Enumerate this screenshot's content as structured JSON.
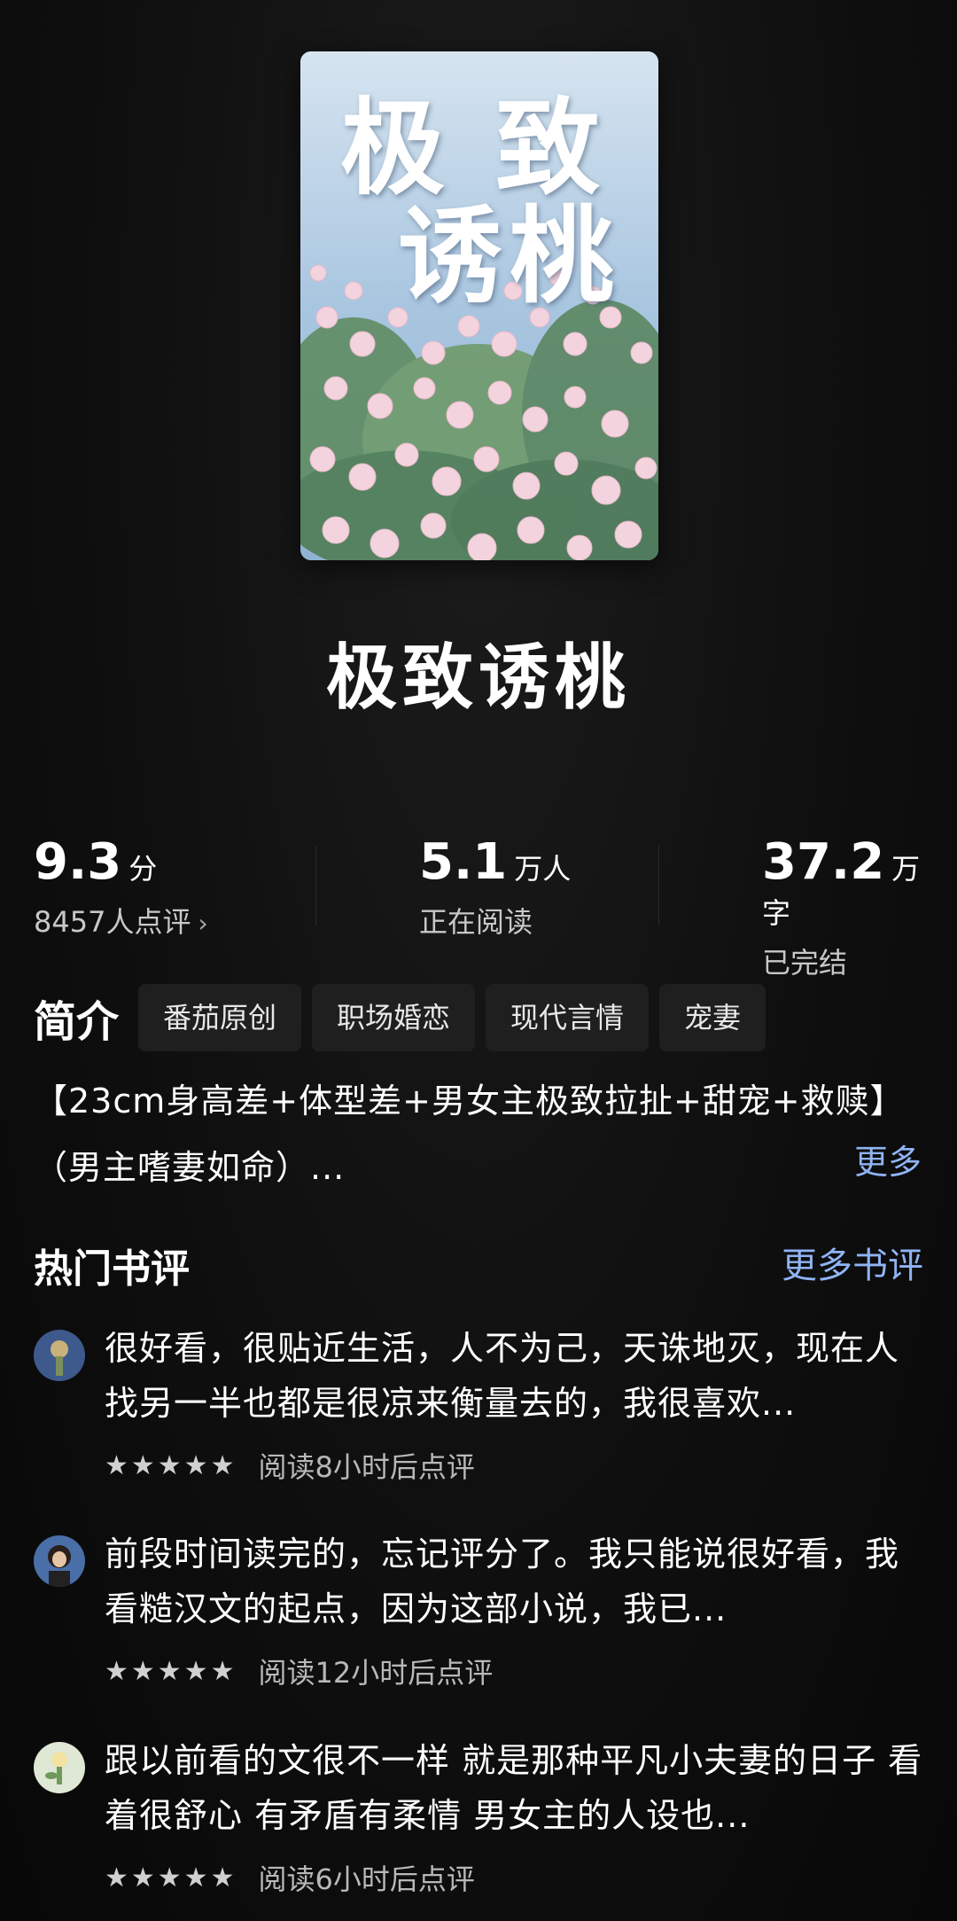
{
  "cover": {
    "title_line1": "极 致",
    "title_line2": "诱桃"
  },
  "book": {
    "title": "极致诱桃"
  },
  "stats": {
    "score": "9.3",
    "score_unit": "分",
    "reviews_count": "8457人点评",
    "readers": "5.1",
    "readers_unit": "万人",
    "readers_label": "正在阅读",
    "words": "37.2",
    "words_unit": "万字",
    "status": "已完结"
  },
  "intro": {
    "label": "简介",
    "tags": [
      "番茄原创",
      "职场婚恋",
      "现代言情",
      "宠妻"
    ],
    "line1": "【23cm身高差+体型差+男女主极致拉扯+甜宠+救赎】",
    "line2": "（男主嗜妻如命）...",
    "more": "更多"
  },
  "reviews": {
    "title": "热门书评",
    "more": "更多书评",
    "items": [
      {
        "text": "很好看，很贴近生活，人不为己，天诛地灭，现在人找另一半也都是很凉来衡量去的，我很喜欢...",
        "stars": "★★★★★",
        "meta": "阅读8小时后点评"
      },
      {
        "text": "前段时间读完的，忘记评分了。我只能说很好看，我看糙汉文的起点，因为这部小说，我已...",
        "stars": "★★★★★",
        "meta": "阅读12小时后点评"
      },
      {
        "text": "跟以前看的文很不一样 就是那种平凡小夫妻的日子 看着很舒心 有矛盾有柔情 男女主的人设也...",
        "stars": "★★★★★",
        "meta": "阅读6小时后点评"
      }
    ]
  },
  "colors": {
    "background": "#0c0c0c",
    "link": "#8fb4f4",
    "tag_bg": "#1f1f1f"
  }
}
